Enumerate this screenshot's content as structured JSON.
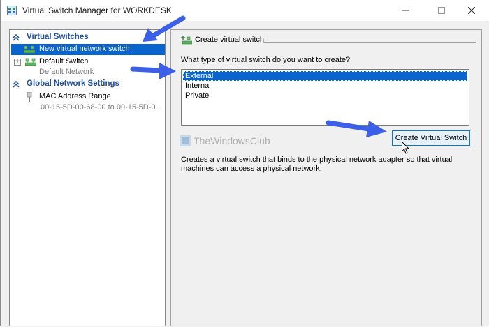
{
  "window": {
    "title": "Virtual Switch Manager for WORKDESK",
    "buttons": {
      "minimize": "—",
      "maximize": "☐",
      "close": "✕"
    }
  },
  "sidebar": {
    "virtual_switches": {
      "header": "Virtual Switches",
      "items": [
        {
          "label": "New virtual network switch",
          "selected": true
        },
        {
          "label": "Default Switch",
          "sub": "Default Network"
        }
      ]
    },
    "global_settings": {
      "header": "Global Network Settings",
      "items": [
        {
          "label": "MAC Address Range",
          "sub": "00-15-5D-00-68-00 to 00-15-5D-0..."
        }
      ]
    }
  },
  "main": {
    "group_title": "Create virtual switch",
    "question": "What type of virtual switch do you want to create?",
    "switch_types": [
      "External",
      "Internal",
      "Private"
    ],
    "selected_type": "External",
    "create_button": "Create Virtual Switch",
    "description": "Creates a virtual switch that binds to the physical network adapter so that virtual machines can access a physical network.",
    "watermark": "TheWindowsClub"
  },
  "colors": {
    "selection": "#0a64d0",
    "header_text": "#1f4e9a",
    "annotation_arrow": "#3b5fe6"
  }
}
